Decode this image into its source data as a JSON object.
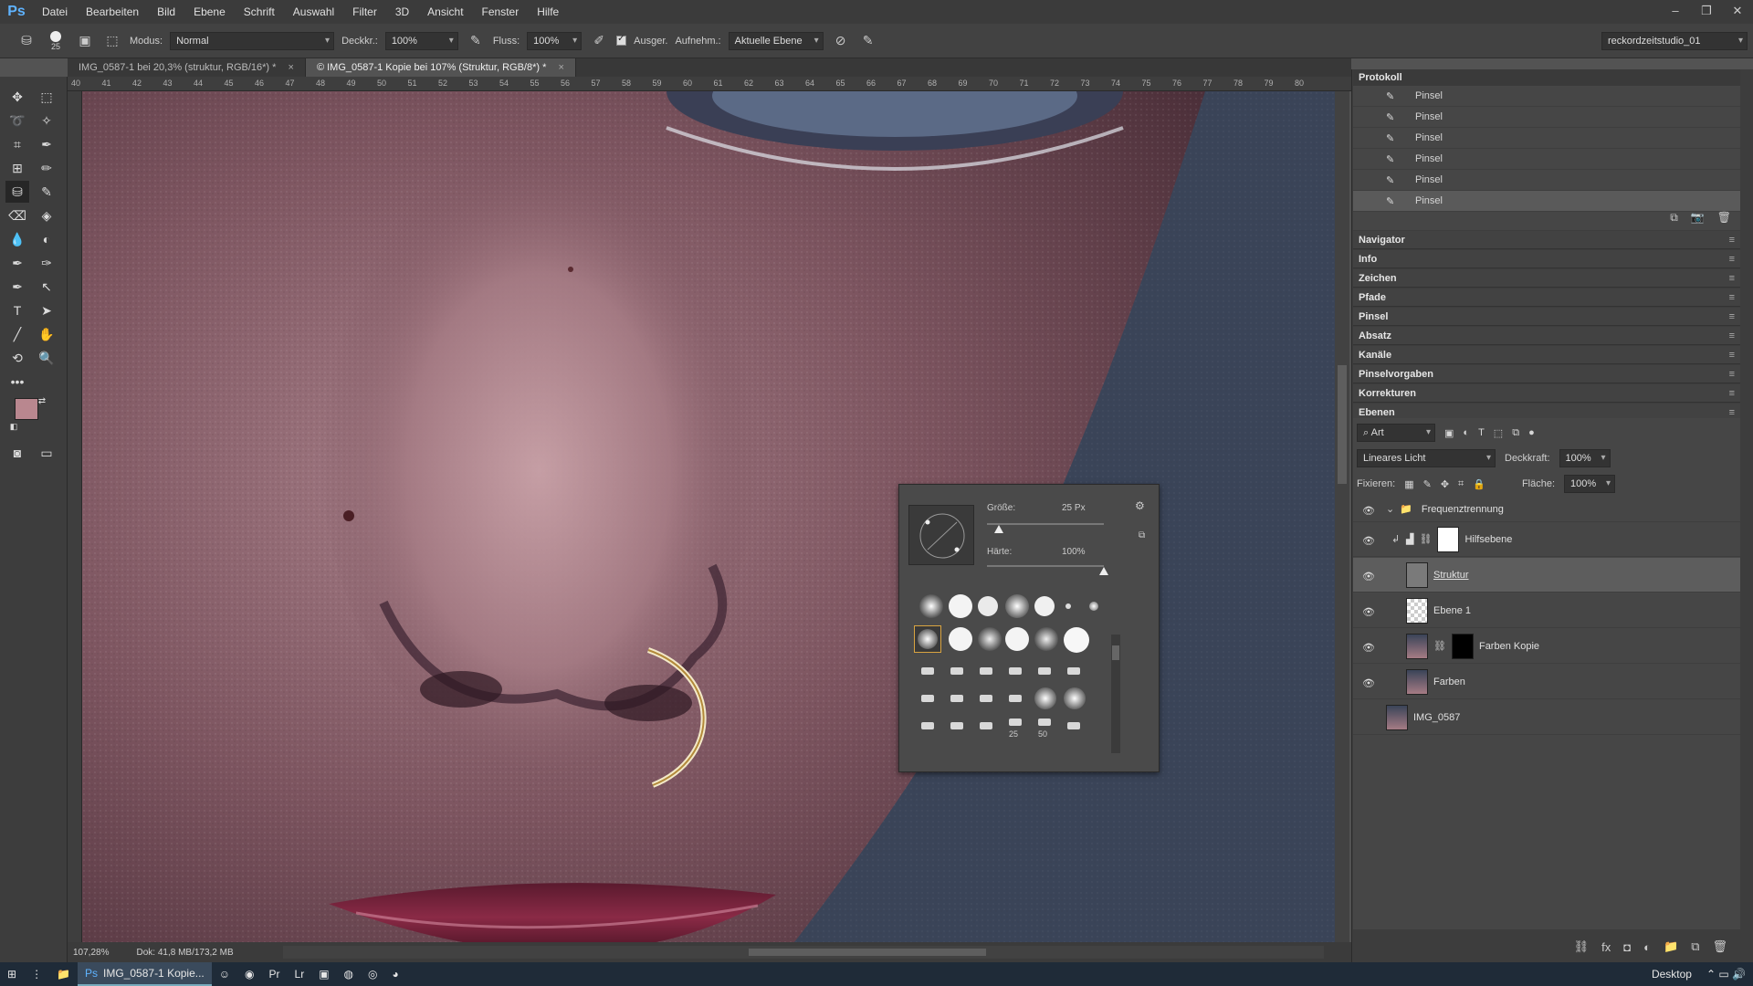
{
  "menu": {
    "logo": "Ps",
    "items": [
      "Datei",
      "Bearbeiten",
      "Bild",
      "Ebene",
      "Schrift",
      "Auswahl",
      "Filter",
      "3D",
      "Ansicht",
      "Fenster",
      "Hilfe"
    ]
  },
  "options": {
    "brush_size": "25",
    "modus_label": "Modus:",
    "modus_value": "Normal",
    "deckkraft_label": "Deckkr.:",
    "deckkraft_value": "100%",
    "fluss_label": "Fluss:",
    "fluss_value": "100%",
    "ausger_label": "Ausger.",
    "aufnehm_label": "Aufnehm.:",
    "aufnehm_value": "Aktuelle Ebene",
    "workspace": "reckordzeitstudio_01"
  },
  "tabs": [
    {
      "label": "IMG_0587-1 bei 20,3% (struktur, RGB/16*) *",
      "close": "×"
    },
    {
      "label": "© IMG_0587-1 Kopie bei 107% (Struktur, RGB/8*) *",
      "close": "×"
    }
  ],
  "ruler": {
    "h_ticks": [
      "40",
      "41",
      "42",
      "43",
      "44",
      "45",
      "46",
      "47",
      "48",
      "49",
      "50",
      "51",
      "52",
      "53",
      "54",
      "55",
      "56",
      "57",
      "58",
      "59",
      "60",
      "61",
      "62",
      "63",
      "64",
      "65",
      "66",
      "67",
      "68",
      "69",
      "70",
      "71",
      "72",
      "73",
      "74",
      "75",
      "76",
      "77",
      "78",
      "79",
      "80"
    ]
  },
  "status": {
    "zoom": "107,28%",
    "doc": "Dok: 41,8 MB/173,2 MB"
  },
  "brush_picker": {
    "size_label": "Größe:",
    "size_value": "25 Px",
    "hardness_label": "Härte:",
    "hardness_value": "100%",
    "size_fraction": 0.1,
    "hardness_fraction": 1.0,
    "tip_labels": [
      "25",
      "50"
    ]
  },
  "protocol": {
    "title": "Protokoll",
    "items": [
      "Pinsel",
      "Pinsel",
      "Pinsel",
      "Pinsel",
      "Pinsel",
      "Pinsel"
    ]
  },
  "panels": [
    "Navigator",
    "Info",
    "Zeichen",
    "Pfade",
    "Pinsel",
    "Absatz",
    "Kanäle",
    "Pinselvorgaben",
    "Korrekturen",
    "Ebenen"
  ],
  "layers": {
    "filter_label": "Art",
    "blend_mode": "Lineares Licht",
    "opacity_label": "Deckkraft:",
    "opacity_value": "100%",
    "lock_label": "Fixieren:",
    "fill_label": "Fläche:",
    "fill_value": "100%",
    "items": [
      {
        "name": "Frequenztrennung",
        "type": "group"
      },
      {
        "name": "Hilfsebene",
        "type": "adjustment"
      },
      {
        "name": "Struktur",
        "type": "layer"
      },
      {
        "name": "Ebene 1",
        "type": "layer"
      },
      {
        "name": "Farben Kopie",
        "type": "layer"
      },
      {
        "name": "Farben",
        "type": "layer"
      },
      {
        "name": "IMG_0587",
        "type": "layer"
      }
    ]
  },
  "taskbar": {
    "active_app": "IMG_0587-1 Kopie...",
    "desktop": "Desktop"
  },
  "colors": {
    "foreground": "#b9878f",
    "background": "#ffffff",
    "accent": "#5fb3ff"
  }
}
